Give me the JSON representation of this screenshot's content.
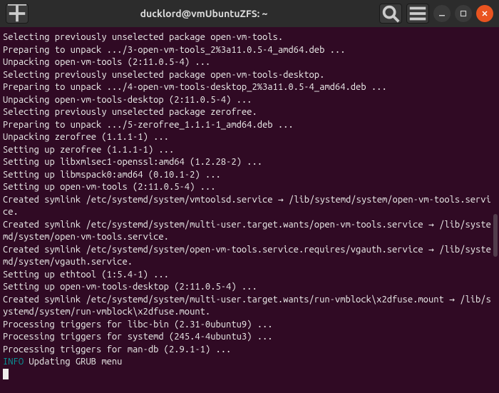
{
  "titlebar": {
    "title": "ducklord@vmUbuntuZFS: ~"
  },
  "terminal": {
    "lines": [
      "Selecting previously unselected package open-vm-tools.",
      "Preparing to unpack .../3-open-vm-tools_2%3a11.0.5-4_amd64.deb ...",
      "Unpacking open-vm-tools (2:11.0.5-4) ...",
      "Selecting previously unselected package open-vm-tools-desktop.",
      "Preparing to unpack .../4-open-vm-tools-desktop_2%3a11.0.5-4_amd64.deb ...",
      "Unpacking open-vm-tools-desktop (2:11.0.5-4) ...",
      "Selecting previously unselected package zerofree.",
      "Preparing to unpack .../5-zerofree_1.1.1-1_amd64.deb ...",
      "Unpacking zerofree (1.1.1-1) ...",
      "Setting up zerofree (1.1.1-1) ...",
      "Setting up libxmlsec1-openssl:amd64 (1.2.28-2) ...",
      "Setting up libmspack0:amd64 (0.10.1-2) ...",
      "Setting up open-vm-tools (2:11.0.5-4) ...",
      "Created symlink /etc/systemd/system/vmtoolsd.service → /lib/systemd/system/open-vm-tools.service.",
      "Created symlink /etc/systemd/system/multi-user.target.wants/open-vm-tools.service → /lib/systemd/system/open-vm-tools.service.",
      "Created symlink /etc/systemd/system/open-vm-tools.service.requires/vgauth.service → /lib/systemd/system/vgauth.service.",
      "Setting up ethtool (1:5.4-1) ...",
      "Setting up open-vm-tools-desktop (2:11.0.5-4) ...",
      "Created symlink /etc/systemd/system/multi-user.target.wants/run-vmblock\\x2dfuse.mount → /lib/systemd/system/run-vmblock\\x2dfuse.mount.",
      "Processing triggers for libc-bin (2.31-0ubuntu9) ...",
      "Processing triggers for systemd (245.4-4ubuntu3) ...",
      "Processing triggers for man-db (2.9.1-1) ..."
    ],
    "info_label": "INFO",
    "info_text": " Updating GRUB menu"
  }
}
